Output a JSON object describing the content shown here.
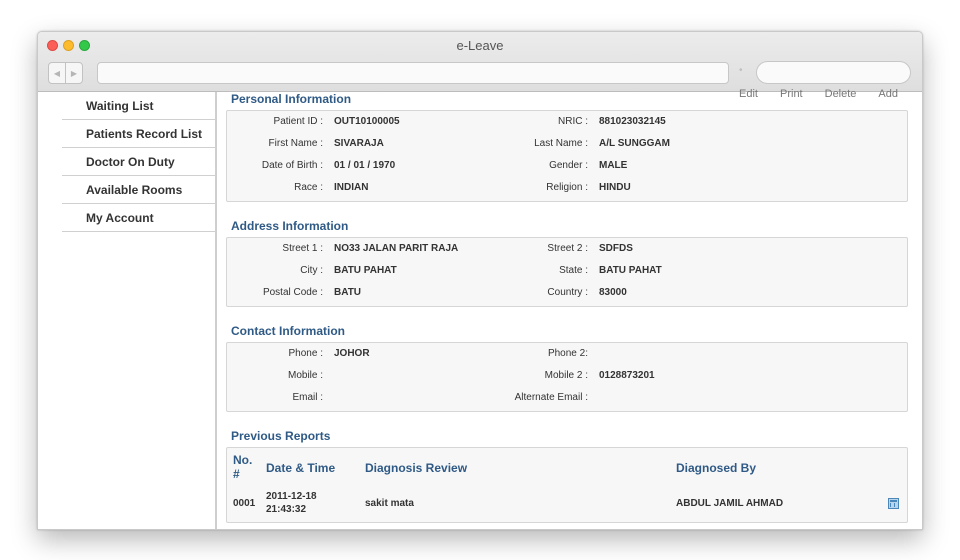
{
  "window": {
    "title": "e-Leave"
  },
  "sidebar": {
    "items": [
      {
        "label": "Waiting List"
      },
      {
        "label": "Patients Record List"
      },
      {
        "label": "Doctor On Duty"
      },
      {
        "label": "Available Rooms"
      },
      {
        "label": "My Account"
      }
    ]
  },
  "actions": {
    "edit": "Edit",
    "print": "Print",
    "delete": "Delete",
    "add": "Add"
  },
  "personal": {
    "title": "Personal Information",
    "patient_id_label": "Patient ID :",
    "patient_id": "OUT10100005",
    "nric_label": "NRIC :",
    "nric": "881023032145",
    "first_name_label": "First Name :",
    "first_name": "SIVARAJA",
    "last_name_label": "Last Name :",
    "last_name": "A/L SUNGGAM",
    "dob_label": "Date of Birth :",
    "dob": "01 / 01 / 1970",
    "gender_label": "Gender :",
    "gender": "MALE",
    "race_label": "Race :",
    "race": "INDIAN",
    "religion_label": "Religion :",
    "religion": "HINDU"
  },
  "address": {
    "title": "Address Information",
    "street1_label": "Street 1 :",
    "street1": "NO33 JALAN PARIT RAJA",
    "street2_label": "Street 2 :",
    "street2": "SDFDS",
    "city_label": "City :",
    "city": "BATU PAHAT",
    "state_label": "State :",
    "state": "BATU PAHAT",
    "postal_label": "Postal Code :",
    "postal": "BATU",
    "country_label": "Country :",
    "country": "83000"
  },
  "contact": {
    "title": "Contact Information",
    "phone_label": "Phone :",
    "phone": "JOHOR",
    "phone2_label": "Phone 2:",
    "phone2": "",
    "mobile_label": "Mobile :",
    "mobile": "",
    "mobile2_label": "Mobile 2 :",
    "mobile2": "0128873201",
    "email_label": "Email :",
    "email": "",
    "alt_email_label": "Alternate Email :",
    "alt_email": ""
  },
  "reports": {
    "title": "Previous Reports",
    "col_no": "No. #",
    "col_datetime": "Date & Time",
    "col_diagnosis": "Diagnosis Review",
    "col_diagnosed_by": "Diagnosed By",
    "rows": [
      {
        "no": "0001",
        "date": "2011-12-18",
        "time": "21:43:32",
        "diagnosis": "sakit mata",
        "by": "ABDUL JAMIL AHMAD"
      }
    ]
  }
}
